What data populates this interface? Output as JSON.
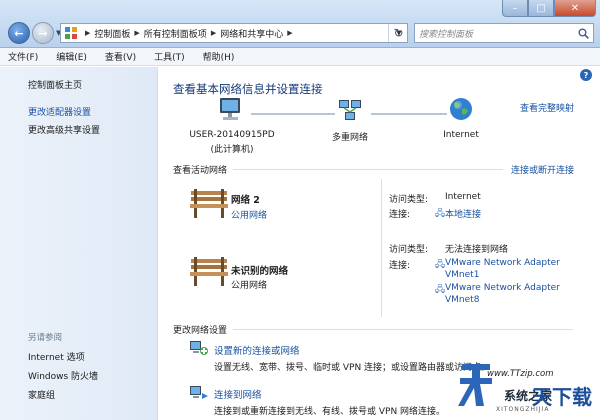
{
  "address": {
    "crumbs": [
      "控制面板",
      "所有控制面板项",
      "网络和共享中心"
    ]
  },
  "search": {
    "placeholder": "搜索控制面板"
  },
  "menu": [
    "文件(F)",
    "编辑(E)",
    "查看(V)",
    "工具(T)",
    "帮助(H)"
  ],
  "left_nav": {
    "home": "控制面板主页",
    "links": [
      "更改适配器设置",
      "更改高级共享设置"
    ],
    "see_also_label": "另请参阅",
    "see_also": [
      "Internet 选项",
      "Windows 防火墙",
      "家庭组"
    ]
  },
  "main": {
    "title": "查看基本网络信息并设置连接",
    "full_map": "查看完整映射",
    "map": {
      "computer_name": "USER-20140915PD",
      "computer_sub": "(此计算机)",
      "middle": "多重网络",
      "internet": "Internet"
    },
    "active_header": "查看活动网络",
    "connect_link": "连接或断开连接",
    "networks": [
      {
        "name": "网络  2",
        "type": "公用网络",
        "access_label": "访问类型:",
        "access_value": "Internet",
        "conn_label": "连接:",
        "connections": [
          "本地连接"
        ]
      },
      {
        "name": "未识别的网络",
        "type": "公用网络",
        "access_label": "访问类型:",
        "access_value": "无法连接到网络",
        "conn_label": "连接:",
        "connections": [
          "VMware Network Adapter",
          "VMnet1",
          "VMware Network Adapter",
          "VMnet8"
        ]
      }
    ],
    "change_header": "更改网络设置",
    "tasks": [
      {
        "link": "设置新的连接或网络",
        "desc": "设置无线、宽带、拨号、临时或 VPN 连接；或设置路由器或访问点。"
      },
      {
        "link": "连接到网络",
        "desc": "连接到或重新连接到无线、有线、拨号或 VPN 网络连接。"
      }
    ]
  },
  "watermark": {
    "url": "www.TTzip.com",
    "big": "天下载",
    "sub": "系统之家",
    "sub2": "XITONGZHIJIA"
  },
  "colors": {
    "link": "#1a51a1",
    "title": "#153a7a",
    "chrome": "#b9d1ec"
  }
}
